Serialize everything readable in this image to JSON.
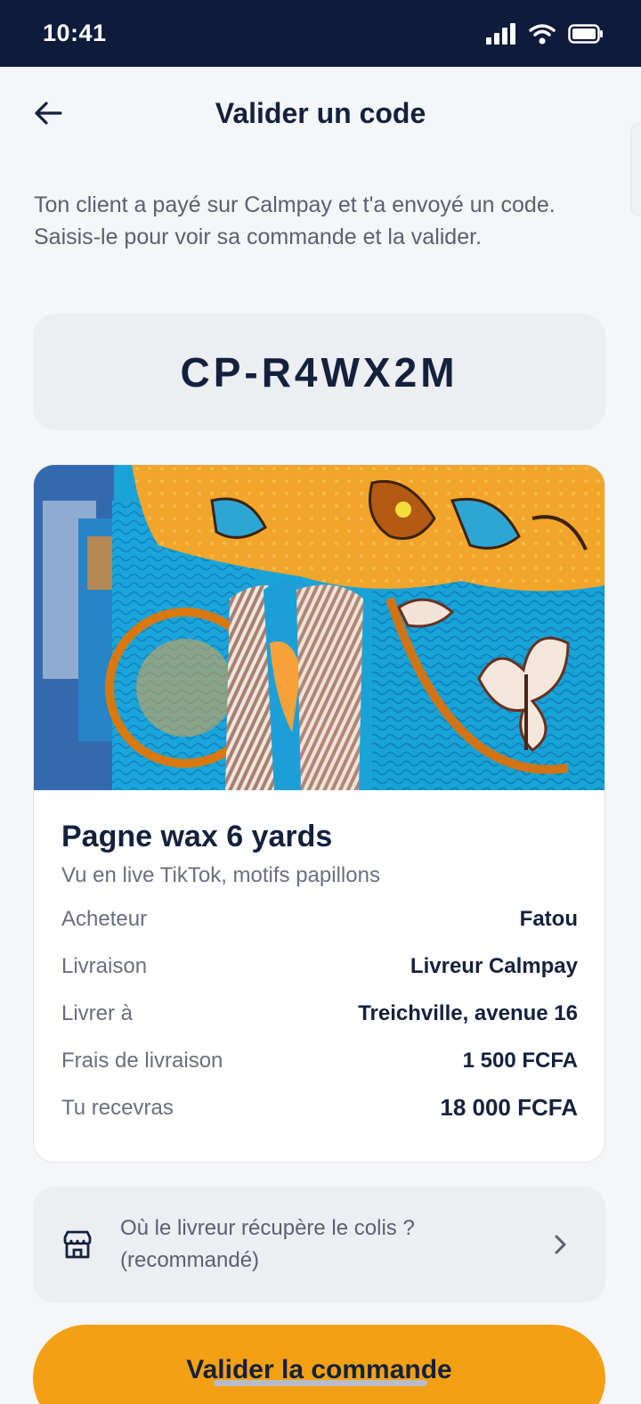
{
  "status_bar": {
    "time": "10:41"
  },
  "header": {
    "title": "Valider un code"
  },
  "intro": {
    "text": "Ton client a payé sur Calmpay et t'a envoyé un code. Saisis-le pour voir sa commande et la valider."
  },
  "code": {
    "value": "CP-R4WX2M"
  },
  "order": {
    "product_title": "Pagne wax 6 yards",
    "product_subtitle": "Vu en live TikTok, motifs papillons",
    "details": [
      {
        "label": "Acheteur",
        "value": "Fatou"
      },
      {
        "label": "Livraison",
        "value": "Livreur Calmpay"
      },
      {
        "label": "Livrer à",
        "value": "Treichville, avenue 16"
      },
      {
        "label": "Frais de livraison",
        "value": "1 500 FCFA"
      },
      {
        "label": "Tu recevras",
        "value": "18 000 FCFA"
      }
    ]
  },
  "pickup": {
    "text": "Où le livreur récupère le colis ? (recommandé)"
  },
  "cta": {
    "label": "Valider la commande"
  },
  "colors": {
    "accent": "#f4a015",
    "navy": "#0f1b3b",
    "text": "#14213d"
  }
}
